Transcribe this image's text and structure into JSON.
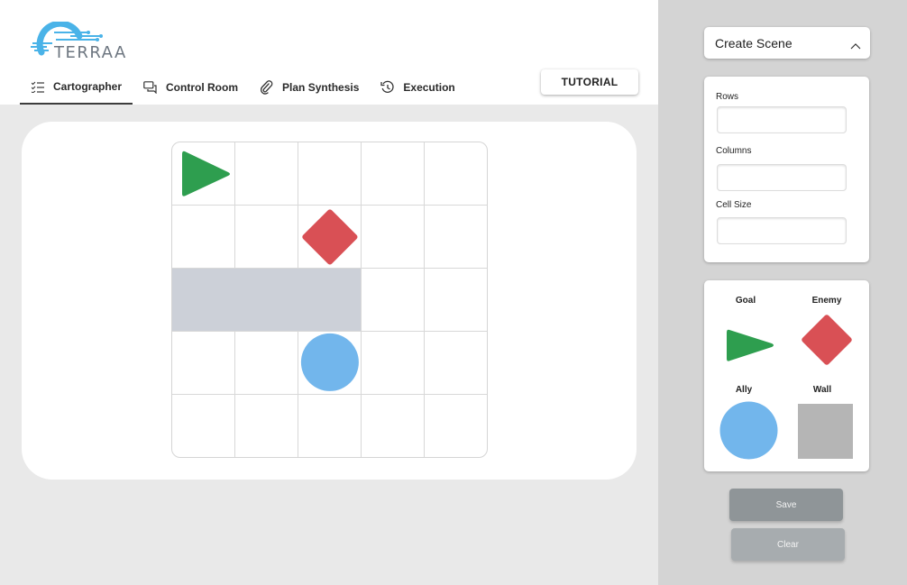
{
  "app": {
    "logo_text": "TERRAA"
  },
  "tabs": [
    {
      "label": "Cartographer",
      "icon": "checklist-icon",
      "active": true
    },
    {
      "label": "Control Room",
      "icon": "chat-bubbles-icon",
      "active": false
    },
    {
      "label": "Plan Synthesis",
      "icon": "paperclip-icon",
      "active": false
    },
    {
      "label": "Execution",
      "icon": "history-icon",
      "active": false
    }
  ],
  "tutorial_label": "TUTORIAL",
  "scene_select": {
    "value": "Create Scene",
    "icon": "chevron-up-icon"
  },
  "form": {
    "rows_label": "Rows",
    "rows_value": "",
    "columns_label": "Columns",
    "columns_value": "",
    "cell_size_label": "Cell Size",
    "cell_size_value": ""
  },
  "palette": {
    "goal_label": "Goal",
    "enemy_label": "Enemy",
    "ally_label": "Ally",
    "wall_label": "Wall"
  },
  "buttons": {
    "save_label": "Save",
    "clear_label": "Clear"
  },
  "grid": {
    "rows": 5,
    "cols": 5,
    "goal": {
      "row": 0,
      "col": 0
    },
    "enemy": {
      "row": 1,
      "col": 2
    },
    "ally": {
      "row": 3,
      "col": 2
    },
    "walls": [
      {
        "row": 2,
        "col": 0
      },
      {
        "row": 2,
        "col": 1
      },
      {
        "row": 2,
        "col": 2
      }
    ]
  },
  "colors": {
    "goal": "#2e9e4f",
    "enemy": "#d95055",
    "ally": "#72b6ec",
    "wall_grid": "#ccd0d8",
    "wall_palette": "#b5b5b5",
    "logo_accent": "#4ab3e8"
  }
}
